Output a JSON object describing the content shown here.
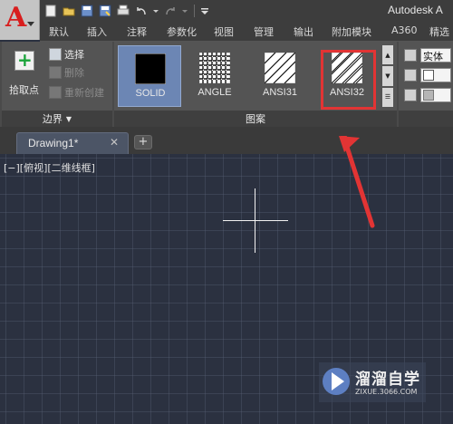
{
  "app": {
    "title": "Autodesk A"
  },
  "menu_tabs": [
    "默认",
    "插入",
    "注释",
    "参数化",
    "视图",
    "管理",
    "输出",
    "附加模块",
    "A360",
    "精选"
  ],
  "boundary_panel": {
    "pick_points_label": "拾取点",
    "select_label": "选择",
    "remove_label": "删除",
    "recreate_label": "重新创建",
    "title": "边界"
  },
  "pattern_panel": {
    "title": "图案",
    "patterns": [
      {
        "name": "SOLID",
        "icon": "solid-fill-icon"
      },
      {
        "name": "ANGLE",
        "icon": "angle-grid-icon"
      },
      {
        "name": "ANSI31",
        "icon": "ansi31-hatch-icon"
      },
      {
        "name": "ANSI32",
        "icon": "ansi32-hatch-icon"
      }
    ],
    "selected": "SOLID",
    "highlighted": "ANSI32"
  },
  "properties_panel": {
    "type_value": "实体"
  },
  "document_tab": {
    "name": "Drawing1*",
    "close_icon": "close-icon",
    "new_tab_icon": "plus-icon"
  },
  "viewport": {
    "label": "[−][俯视][二维线框]"
  },
  "watermark": {
    "name": "溜溜自学",
    "url": "ZIXUE.3066.COM"
  },
  "colors": {
    "accent_red": "#e23434",
    "selection_blue": "#6c86b4",
    "canvas_bg": "#2b3140"
  }
}
